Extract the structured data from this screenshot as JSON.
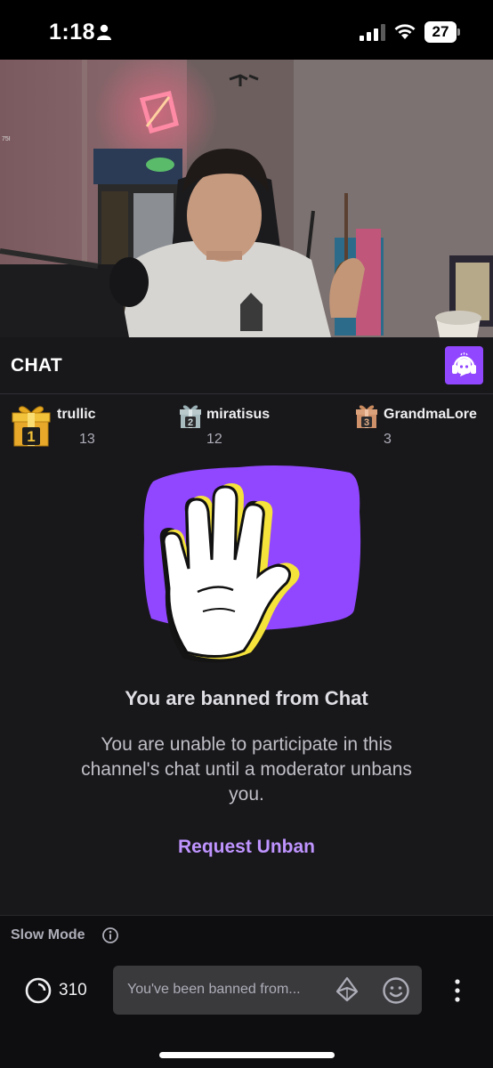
{
  "status_bar": {
    "time": "1:18",
    "battery": "27",
    "icons": [
      "person-icon",
      "signal-icon",
      "wifi-icon",
      "battery-icon"
    ]
  },
  "video": {
    "viewer_count_text": "75I"
  },
  "chat": {
    "title": "CHAT",
    "app_icon": "chat-bot-headphones-icon",
    "accent_color": "#9147ff"
  },
  "leaderboard": [
    {
      "rank": "1",
      "name": "trullic",
      "count": "13",
      "icon": "gold-gift-icon"
    },
    {
      "rank": "2",
      "name": "miratisus",
      "count": "12",
      "icon": "silver-gift-icon"
    },
    {
      "rank": "3",
      "name": "GrandmaLore",
      "count": "3",
      "icon": "bronze-gift-icon"
    }
  ],
  "ban": {
    "title": "You are banned from Chat",
    "description": "You are unable to participate in this channel's chat until a moderator unbans you.",
    "request_label": "Request Unban",
    "illustration": "raised-hand-icon",
    "link_color": "#bf94ff"
  },
  "bottom": {
    "slow_mode_label": "Slow Mode",
    "points": "310",
    "input_placeholder": "You've been banned from...",
    "icons": [
      "info-icon",
      "channel-points-icon",
      "bits-icon",
      "emote-icon",
      "more-icon"
    ]
  }
}
